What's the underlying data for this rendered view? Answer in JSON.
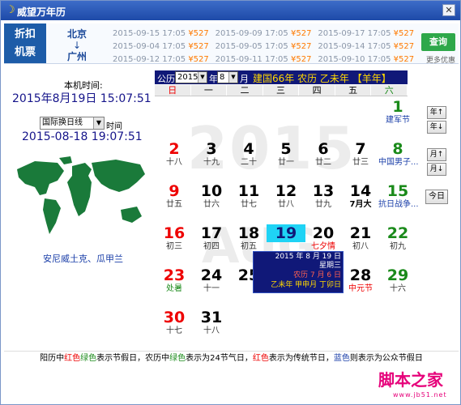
{
  "window": {
    "title": "威望万年历",
    "close": "✕"
  },
  "banner": {
    "tag_line1": "折扣",
    "tag_line2": "机票",
    "from": "北京",
    "arrow": "↓",
    "to": "广州",
    "flights": [
      [
        {
          "date": "2015-09-15 17:05",
          "price": "¥527"
        },
        {
          "date": "2015-09-09 17:05",
          "price": "¥527"
        },
        {
          "date": "2015-09-17 17:05",
          "price": "¥527"
        }
      ],
      [
        {
          "date": "2015-09-04 17:05",
          "price": "¥527"
        },
        {
          "date": "2015-09-05 17:05",
          "price": "¥527"
        },
        {
          "date": "2015-09-14 17:05",
          "price": "¥527"
        }
      ],
      [
        {
          "date": "2015-09-12 17:05",
          "price": "¥527"
        },
        {
          "date": "2015-09-11 17:05",
          "price": "¥527"
        },
        {
          "date": "2015-09-10 17:05",
          "price": "¥527"
        }
      ]
    ],
    "query": "查询",
    "more": "更多优惠"
  },
  "left": {
    "local_label": "本机时间:",
    "local_datetime": "2015年8月19日  15:07:51",
    "tz_select": "国际换日线",
    "tz_suffix": "时间",
    "tz_datetime": "2015-08-18 19:07:51",
    "city": "安尼威土克、瓜甲兰"
  },
  "header": {
    "solar_label": "公历",
    "year": "2015",
    "year_suffix": "年",
    "month": "8",
    "month_suffix": "月",
    "lunar_title": "建国66年 农历 乙未年 【羊年】"
  },
  "weekdays": [
    "日",
    "一",
    "二",
    "三",
    "四",
    "五",
    "六"
  ],
  "watermark": {
    "year": "2015",
    "month": "AUG"
  },
  "days": [
    {
      "n": "1",
      "sub": "建军节",
      "col": 6,
      "row": 0,
      "cls": "blue"
    },
    {
      "n": "2",
      "sub": "十八",
      "col": 0,
      "row": 1
    },
    {
      "n": "3",
      "sub": "十九",
      "col": 1,
      "row": 1
    },
    {
      "n": "4",
      "sub": "二十",
      "col": 2,
      "row": 1
    },
    {
      "n": "5",
      "sub": "廿一",
      "col": 3,
      "row": 1
    },
    {
      "n": "6",
      "sub": "廿二",
      "col": 4,
      "row": 1
    },
    {
      "n": "7",
      "sub": "廿三",
      "col": 5,
      "row": 1
    },
    {
      "n": "8",
      "sub": "中国男子...",
      "col": 6,
      "row": 1,
      "cls": "blue"
    },
    {
      "n": "9",
      "sub": "廿五",
      "col": 0,
      "row": 2
    },
    {
      "n": "10",
      "sub": "廿六",
      "col": 1,
      "row": 2
    },
    {
      "n": "11",
      "sub": "廿七",
      "col": 2,
      "row": 2
    },
    {
      "n": "12",
      "sub": "廿八",
      "col": 3,
      "row": 2
    },
    {
      "n": "13",
      "sub": "廿九",
      "col": 4,
      "row": 2
    },
    {
      "n": "14",
      "sub": "7月大",
      "col": 5,
      "row": 2,
      "cls": "bold"
    },
    {
      "n": "15",
      "sub": "抗日战争...",
      "col": 6,
      "row": 2,
      "cls": "blue"
    },
    {
      "n": "16",
      "sub": "初三",
      "col": 0,
      "row": 3
    },
    {
      "n": "17",
      "sub": "初四",
      "col": 1,
      "row": 3
    },
    {
      "n": "18",
      "sub": "初五",
      "col": 2,
      "row": 3
    },
    {
      "n": "19",
      "sub": "",
      "col": 3,
      "row": 3,
      "today": true
    },
    {
      "n": "20",
      "sub": "七夕情",
      "col": 4,
      "row": 3,
      "cls": "red"
    },
    {
      "n": "21",
      "sub": "初八",
      "col": 5,
      "row": 3
    },
    {
      "n": "22",
      "sub": "初九",
      "col": 6,
      "row": 3
    },
    {
      "n": "23",
      "sub": "处暑",
      "col": 0,
      "row": 4,
      "cls": "green"
    },
    {
      "n": "24",
      "sub": "十一",
      "col": 1,
      "row": 4
    },
    {
      "n": "25",
      "sub": "",
      "col": 2,
      "row": 4
    },
    {
      "n": "28",
      "sub": "中元节",
      "col": 5,
      "row": 4,
      "cls": "red"
    },
    {
      "n": "29",
      "sub": "十六",
      "col": 6,
      "row": 4
    },
    {
      "n": "30",
      "sub": "十七",
      "col": 0,
      "row": 5
    },
    {
      "n": "31",
      "sub": "十八",
      "col": 1,
      "row": 5
    }
  ],
  "popup": {
    "line1": "2015 年 8 月 19 日",
    "line2": "星期三",
    "line3": "农历 7 月 6 日",
    "line4": "乙未年 甲申月 丁卯日"
  },
  "buttons": {
    "year_up": "年↑",
    "year_down": "年↓",
    "month_up": "月↑",
    "month_down": "月↓",
    "today": "今日"
  },
  "footer": {
    "p1": "阳历中",
    "red1": "红色",
    "green1": "绿色",
    "p2": "表示节假日，农历中",
    "green2": "绿色",
    "p3": "表示为24节气日，",
    "red2": "红色",
    "p4": "表示为传统节日，",
    "blue1": "蓝色",
    "p5": "则表示为公众节假日"
  },
  "site": {
    "logo": "脚本之家",
    "url": "www.jb51.net"
  },
  "colors": {
    "header_bg": "#101878",
    "today_bg": "#1fd3f5",
    "sunday": "#e00000",
    "saturday": "#1a8a1a"
  }
}
